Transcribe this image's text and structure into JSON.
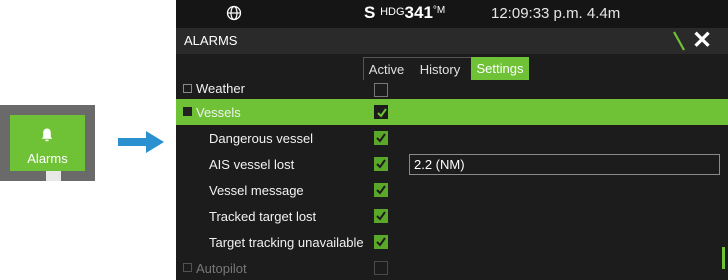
{
  "tile": {
    "label": "Alarms",
    "icon": "bell-icon"
  },
  "statusbar": {
    "heading_prefix": "S",
    "heading_label": "HDG",
    "heading_value": "341",
    "heading_unit": "°M",
    "time": "12:09:33 p.m.",
    "distance": "4.4m"
  },
  "window": {
    "title": "ALARMS"
  },
  "tabs": [
    {
      "label": "Active",
      "active": false
    },
    {
      "label": "History",
      "active": false
    },
    {
      "label": "Settings",
      "active": true
    }
  ],
  "rows": [
    {
      "label": "Weather",
      "checked": false
    },
    {
      "label": "Vessels",
      "checked": true,
      "selected": true
    },
    {
      "label": "Dangerous vessel",
      "checked": true
    },
    {
      "label": "AIS vessel lost",
      "checked": true,
      "value": "2.2 (NM)"
    },
    {
      "label": "Vessel message",
      "checked": true
    },
    {
      "label": "Tracked target lost",
      "checked": true
    },
    {
      "label": "Target tracking unavailable",
      "checked": true
    },
    {
      "label": "Autopilot",
      "checked": false
    }
  ],
  "colors": {
    "accent": "#6fc236",
    "background": "#1c1c1c",
    "arrow": "#2a90d0"
  }
}
